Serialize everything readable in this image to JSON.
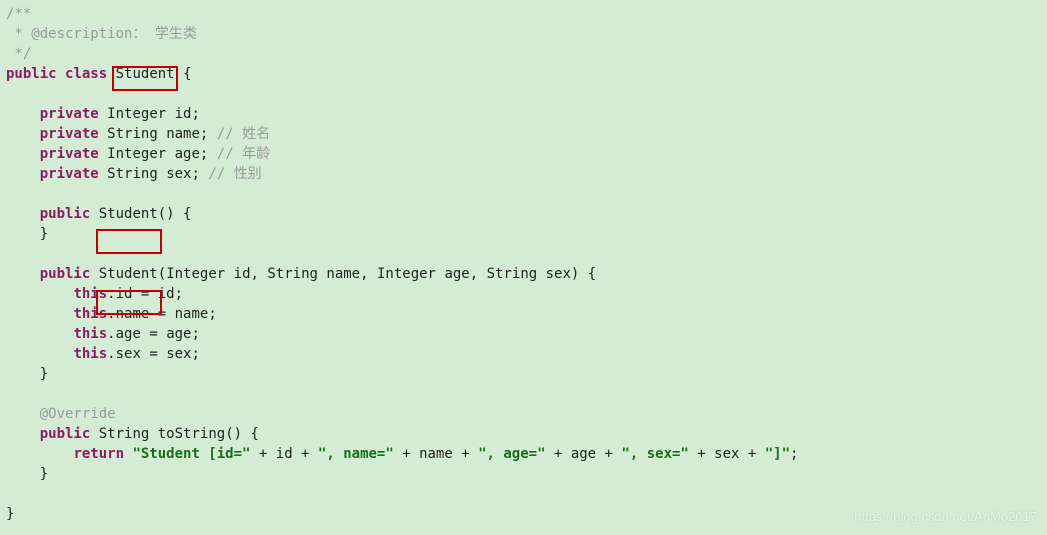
{
  "code": {
    "doc1": "/**",
    "doc2": " * @description",
    "doc2b": "： 学生类",
    "doc3": " */",
    "kw_public": "public",
    "kw_class": "class",
    "kw_private": "private",
    "kw_return": "return",
    "kw_this": "this",
    "class_name": "Student",
    "lbrace": "{",
    "rbrace": "}",
    "lparen": "(",
    "rparen": ")",
    "semi": ";",
    "comma": ",",
    "dot": ".",
    "assign": " = ",
    "plus": " + ",
    "empty_parens": "()",
    "type_Integer": "Integer",
    "type_String": "String",
    "field_id": "id",
    "field_name": "name",
    "field_age": "age",
    "field_sex": "sex",
    "cmt_name": "// 姓名",
    "cmt_age": "// 年龄",
    "cmt_sex": "// 性别",
    "anno_override": "@Override",
    "method_toString": "toString",
    "str_open": "\"Student [id=\"",
    "str_name": "\", name=\"",
    "str_age": "\", age=\"",
    "str_sex": "\", sex=\"",
    "str_close": "\"]\""
  },
  "watermark": "https://blog.csdn.net/AnMo2017"
}
